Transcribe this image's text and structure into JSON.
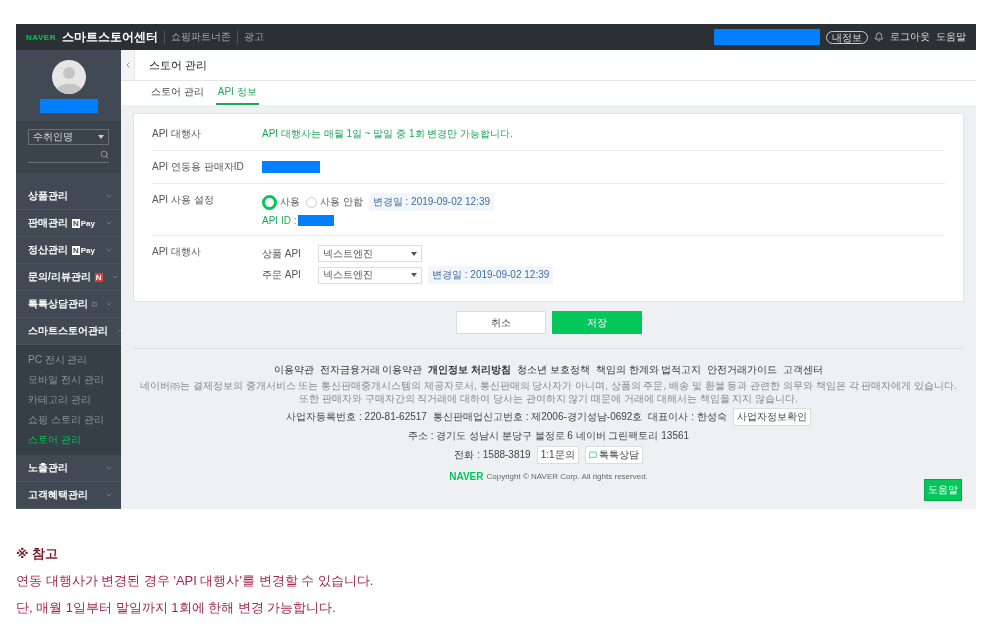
{
  "topbar": {
    "logo": "NAVER",
    "title": "스마트스토어센터",
    "links": [
      "쇼핑파트너존",
      "광고"
    ],
    "my_info": "내정보",
    "logout": "로그아웃",
    "help": "도움말"
  },
  "sidebar": {
    "search_type": "수취인명",
    "items": [
      {
        "label": "상품관리",
        "expanded": false
      },
      {
        "label": "판매관리",
        "expanded": false,
        "badge": {
          "kind": "npay",
          "mark": "N",
          "text": "Pay"
        }
      },
      {
        "label": "정산관리",
        "expanded": false,
        "badge": {
          "kind": "npay",
          "mark": "N",
          "text": "Pay"
        }
      },
      {
        "label": "문의/리뷰관리",
        "expanded": false,
        "badge": {
          "kind": "new",
          "mark": "N"
        }
      },
      {
        "label": "톡톡상담관리",
        "expanded": false,
        "badge": {
          "kind": "talk"
        }
      },
      {
        "label": "스마트스토어관리",
        "expanded": true,
        "children": [
          {
            "label": "PC 전시 관리",
            "selected": false
          },
          {
            "label": "모바일 전시 관리",
            "selected": false
          },
          {
            "label": "카테고리 관리",
            "selected": false
          },
          {
            "label": "쇼핑 스토리 관리",
            "selected": false
          },
          {
            "label": "스토어 관리",
            "selected": true
          }
        ]
      },
      {
        "label": "노출관리",
        "expanded": false
      },
      {
        "label": "고객혜택관리",
        "expanded": false
      }
    ]
  },
  "page_title": "스토어 관리",
  "tabs": [
    {
      "label": "스토어 관리",
      "selected": false
    },
    {
      "label": "API 정보",
      "selected": true
    }
  ],
  "form": {
    "rows": [
      {
        "kind": "notice",
        "label": "API 대행사",
        "text": "API 대행사는 매월 1일 ~ 말일 중 1회 변경만 가능합니다."
      },
      {
        "kind": "hidden",
        "label": "API 연동용 판매자ID"
      },
      {
        "kind": "radio",
        "label": "API 사용 설정",
        "options": [
          {
            "label": "사용",
            "selected": true
          },
          {
            "label": "사용 안함",
            "selected": false
          }
        ],
        "changed": "변경일 : 2019-09-02 12:39",
        "api_id": "API ID :"
      },
      {
        "kind": "selects",
        "label": "API 대행사",
        "selects": [
          {
            "label": "상품 API",
            "value": "넥스트엔진"
          },
          {
            "label": "주문 API",
            "value": "넥스트엔진",
            "changed": "변경일 : 2019-09-02 12:39"
          }
        ]
      }
    ]
  },
  "buttons": {
    "cancel": "취소",
    "save": "저장"
  },
  "footer": {
    "links": [
      {
        "label": "이용약관",
        "bold": false
      },
      {
        "label": "전자금융거래 이용약관",
        "bold": false
      },
      {
        "label": "개인정보 처리방침",
        "bold": true
      },
      {
        "label": "청소년 보호정책",
        "bold": false
      },
      {
        "label": "책임의 한계와 법적고지",
        "bold": false
      },
      {
        "label": "안전거래가이드",
        "bold": false
      },
      {
        "label": "고객센터",
        "bold": false
      }
    ],
    "disclaimer": [
      "네이버㈜는 결제정보의 중개서비스 또는 통신판매중개시스템의 제공자로서, 통신판매의 당사자가 아니며, 상품의 주문, 배송 및 환불 등과 관련한 의무와 책임은 각 판매자에게 있습니다.",
      "또한 판매자와 구매자간의 직거래에 대하여 당사는 관여하지 않기 때문에 거래에 대해서는 책임을 지지 않습니다."
    ],
    "business": [
      "사업자등록번호 : 220-81-62517",
      "통신판매업신고번호 : 제2006-경기성남-0692호",
      "대표이사 : 한성숙"
    ],
    "business_button": "사업자정보확인",
    "address": "주소 : 경기도 성남시 분당구 불정로 6 네이버 그린팩토리 13561",
    "phone": "전화 : 1588-3819",
    "inquiry": "1:1문의",
    "talk": "톡톡상담",
    "logo": "NAVER",
    "copyright": "Copyright © NAVER Corp. All rights reserved."
  },
  "help_button": "도움말",
  "note": {
    "title": "※ 참고",
    "lines": [
      "연동 대행사가 변경된 경우 'API 대행사'를 변경할 수 있습니다.",
      "단, 매월 1일부터 말일까지 1회에 한해 변경 가능합니다."
    ]
  }
}
